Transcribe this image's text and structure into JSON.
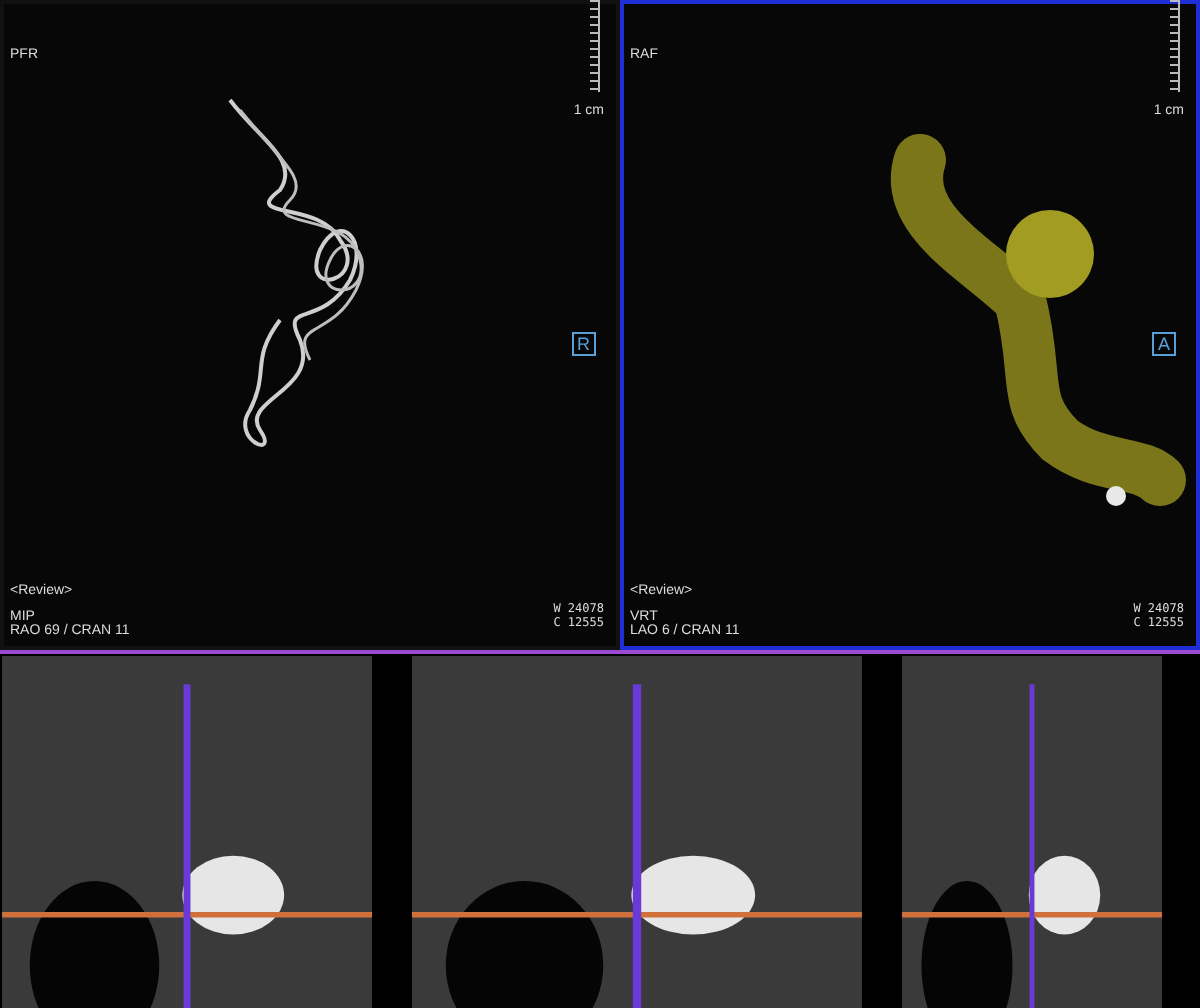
{
  "viewports": [
    {
      "kind": "mip",
      "selected": false,
      "orientation": "PFR",
      "scale_label": "1 cm",
      "orientation_marker": "R",
      "status": "<Review>",
      "render_mode": "MIP",
      "angle": "RAO 69 / CRAN 11",
      "window_width": "W 24078",
      "window_center": "C 12555"
    },
    {
      "kind": "vrt",
      "selected": true,
      "orientation": "RAF",
      "scale_label": "1 cm",
      "orientation_marker": "A",
      "status": "<Review>",
      "render_mode": "VRT",
      "angle": "LAO 6 / CRAN 11",
      "window_width": "W 24078",
      "window_center": "C 12555"
    }
  ],
  "slices": [
    {
      "selected": false
    },
    {
      "selected": false
    },
    {
      "selected": false
    }
  ]
}
